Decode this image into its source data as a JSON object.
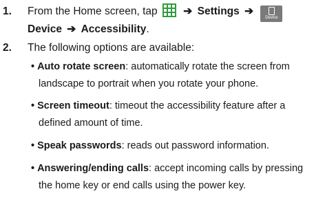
{
  "steps": [
    {
      "number": "1.",
      "line1_text": "From the Home screen, tap",
      "apps_icon": "apps-grid-icon",
      "arrow": "➔",
      "settings": "Settings",
      "device_icon_label": "Device",
      "device": "Device",
      "accessibility": "Accessibility",
      "period": "."
    },
    {
      "number": "2.",
      "text": "The following options are available:"
    }
  ],
  "options": [
    {
      "term": "Auto rotate screen",
      "desc_line1": ": automatically rotate the screen from",
      "desc_line2": "landscape to portrait when you rotate your phone."
    },
    {
      "term": "Screen timeout",
      "desc_line1": ": timeout the accessibility feature after a",
      "desc_line2": "defined amount of time."
    },
    {
      "term": "Speak passwords",
      "desc_line1": ": reads out password information."
    },
    {
      "term": "Answering/ending calls",
      "desc_line1": ": accept incoming calls by pressing",
      "desc_line2": "the home key or end calls using the power key."
    }
  ],
  "colors": {
    "apps_icon": "#2e9c3c",
    "device_icon_bg": "#7a7a7a",
    "text": "#1a1a1a"
  }
}
